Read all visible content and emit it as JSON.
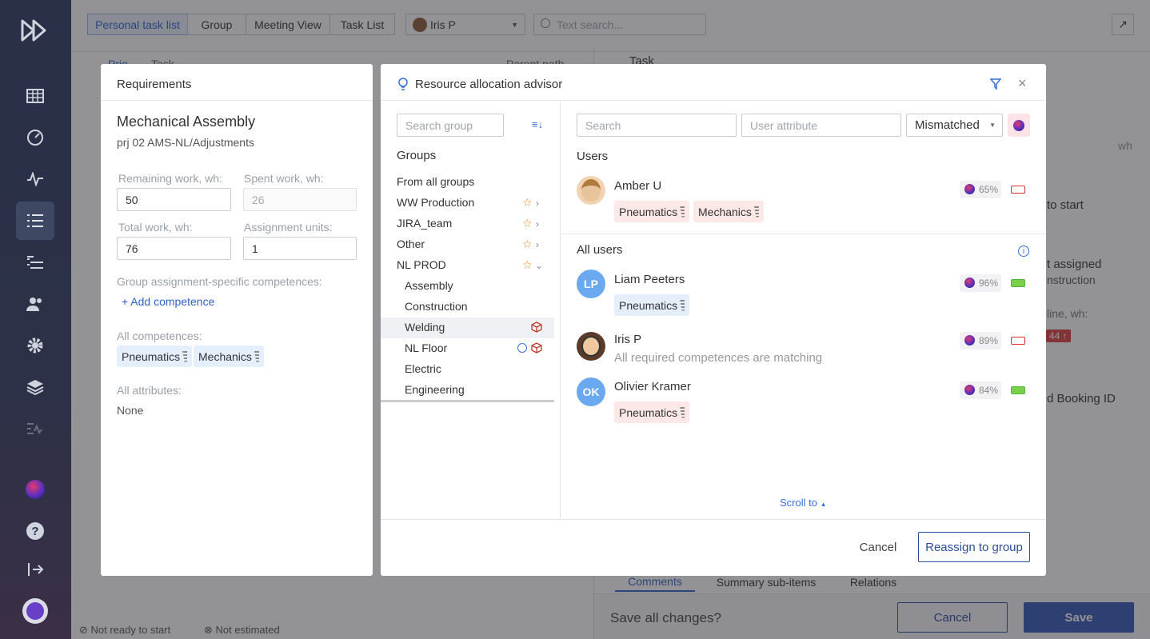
{
  "topbar": {
    "tabs": [
      "Personal task list",
      "Group",
      "Meeting View",
      "Task List"
    ],
    "user": "Iris P",
    "search_placeholder": "Text search..."
  },
  "background": {
    "col_prio": "Prio",
    "col_task": "Task",
    "col_parent": "Parent path",
    "task_header": "Task",
    "unit_wh": "wh",
    "to_start": "to start",
    "t_assigned": "t assigned",
    "construction": "nstruction",
    "line_wh": "line, wh:",
    "badge_44": "44 ↑",
    "booking": "d Booking ID",
    "bottom_tabs": [
      "Comments",
      "Summary sub-items",
      "Relations"
    ],
    "save_prompt": "Save all changes?",
    "cancel": "Cancel",
    "save": "Save",
    "status_not_ready": "Not ready to start",
    "status_not_estimated": "Not estimated"
  },
  "requirements": {
    "title": "Requirements",
    "task_name": "Mechanical Assembly",
    "task_path": "prj 02 AMS-NL/Adjustments",
    "remaining_label": "Remaining work, wh:",
    "remaining_value": "50",
    "spent_label": "Spent work, wh:",
    "spent_value": "26",
    "total_label": "Total work, wh:",
    "total_value": "76",
    "units_label": "Assignment units:",
    "units_value": "1",
    "group_comp_label": "Group assignment-specific competences:",
    "add_competence": "+ Add competence",
    "all_comp_label": "All competences:",
    "competences": [
      "Pneumatics",
      "Mechanics"
    ],
    "all_attr_label": "All attributes:",
    "attributes_value": "None"
  },
  "advisor": {
    "title": "Resource allocation advisor",
    "search_group_placeholder": "Search group",
    "groups_heading": "Groups",
    "groups": [
      {
        "name": "From all groups"
      },
      {
        "name": "WW Production"
      },
      {
        "name": "JIRA_team"
      },
      {
        "name": "Other"
      },
      {
        "name": "NL PROD"
      }
    ],
    "subgroups": [
      "Assembly",
      "Construction",
      "Welding",
      "NL Floor",
      "Electric",
      "Engineering"
    ],
    "search_placeholder": "Search",
    "attr_placeholder": "User attribute",
    "filter_value": "Mismatched",
    "users_heading": "Users",
    "all_users_heading": "All users",
    "users": [
      {
        "name": "Amber U",
        "pct": "65%",
        "chips": [
          "Pneumatics",
          "Mechanics"
        ]
      }
    ],
    "all_users": [
      {
        "initials": "LP",
        "name": "Liam Peeters",
        "pct": "96%",
        "chips": [
          "Pneumatics"
        ],
        "note": ""
      },
      {
        "initials": "",
        "name": "Iris P",
        "pct": "89%",
        "chips": [],
        "note": "All required competences are matching"
      },
      {
        "initials": "OK",
        "name": "Olivier Kramer",
        "pct": "84%",
        "chips": [
          "Pneumatics"
        ],
        "note": ""
      }
    ],
    "scroll_to": "Scroll to",
    "cancel": "Cancel",
    "reassign": "Reassign to group"
  }
}
